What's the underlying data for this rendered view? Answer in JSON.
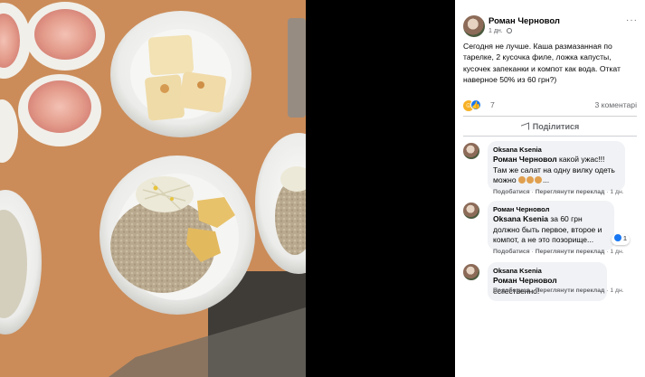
{
  "post": {
    "author": "Роман Черновол",
    "time": "1 дн.",
    "more_label": "···",
    "text": "Сегодня не лучше. Каша размазанная по тарелке, 2 кусочка филе, ложка капусты, кусочек запеканки и компот как вода. Откат наверное 50% из 60 грн?)",
    "reaction_count": "7",
    "comment_count": "3 коментарі",
    "share_label": "Поділитися"
  },
  "comments": [
    {
      "author": "Oksana Ksenia",
      "mention": "Роман Черновол",
      "text": "какой ужас!!! Там же салат на одну вилку одеть можно",
      "emoji_tail": "...",
      "action_share": "Подобатися",
      "action_translate": "Переглянути переклад",
      "time": "1 дн."
    },
    {
      "author": "Роман Черновол",
      "mention": "Oksana Ksenia",
      "text": "за 60 грн должно быть первое, второе и компот, а не это позорище...",
      "like_count": "1",
      "action_share": "Подобатися",
      "action_translate": "Переглянути переклад",
      "time": "1 дн."
    },
    {
      "author": "Oksana Ksenia",
      "mention": "Роман Черновол",
      "text": "естественно!",
      "action_share": "Подобатися",
      "action_translate": "Переглянути переклад",
      "time": "1 дн."
    }
  ],
  "colors": {
    "table": "#c98a55",
    "plate": "#f4f4f2",
    "compote": "#e9a393",
    "link_blue": "#1877f2",
    "muted": "#65676b"
  }
}
